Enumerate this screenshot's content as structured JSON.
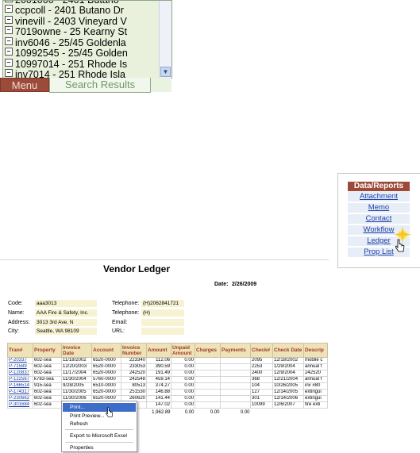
{
  "search_results": {
    "items": [
      "ccpcoll - 2401 Butano Dr",
      "vinevill - 2403 Vineyard V",
      "7019owne - 25 Kearny St",
      "inv6046 - 25/45 Goldenla",
      "10992545 - 25/45 Golden",
      "10997014 - 251 Rhode Is",
      "inv7014 - 251 Rhode Isla"
    ],
    "tabs": {
      "menu": "Menu",
      "search": "Search Results"
    }
  },
  "reports": {
    "header": "Data/Reports",
    "links": [
      "Attachment",
      "Memo",
      "Contact",
      "Workflow",
      "Ledger",
      "Prop List"
    ]
  },
  "ledger": {
    "title": "Vendor Ledger",
    "date_label": "Date:",
    "date": "2/26/2009",
    "fields": {
      "code_label": "Code:",
      "code": "aaa3013",
      "name_label": "Name:",
      "name": "AAA Fire & Safety, Inc.",
      "address_label": "Address:",
      "address": "3013 3rd Ave. N",
      "city_label": "City:",
      "city": "Seattle, WA 98109",
      "tel_label": "Telephone:",
      "tel": "(H)2062841721",
      "tel2_label": "Telephone:",
      "tel2": "(H)",
      "email_label": "Email:",
      "email": "",
      "url_label": "URL:",
      "url": ""
    },
    "columns": [
      "Tran#",
      "Property",
      "Invoice Date",
      "Account",
      "Invoice Number",
      "Amount",
      "Unpaid Amount",
      "Charges",
      "Payments",
      "Check#",
      "Check Date",
      "Descrip"
    ],
    "rows": [
      [
        "P-20337",
        "602-sea",
        "11/18/2002",
        "6520-0000",
        "223340",
        "112.06",
        "0.00",
        "",
        "",
        "2095",
        "12/18/2002",
        "mobile c"
      ],
      [
        "P-71589",
        "602-sea",
        "12/20/2003",
        "6520-0000",
        "233053",
        "390.59",
        "0.00",
        "",
        "",
        "2253",
        "1/29/2004",
        "annual f"
      ],
      [
        "P-120837",
        "602-sea",
        "11/17/2004",
        "6520-0000",
        "242520",
        "191.49",
        "0.00",
        "",
        "",
        "2400",
        "12/9/2004",
        "242520"
      ],
      [
        "P-122567",
        "k783-sea",
        "11/30/2004",
        "5760-0000",
        "242548",
        "459.14",
        "0.00",
        "",
        "",
        "368",
        "12/21/2004",
        "annual f"
      ],
      [
        "P-166514",
        "915-sea",
        "9/28/2005",
        "6510-0000",
        "80513",
        "374.27",
        "0.00",
        "",
        "",
        "104",
        "10/26/2005",
        "inv #80"
      ],
      [
        "P-174317",
        "602-sea",
        "11/30/2005",
        "6520-0000",
        "251530",
        "146.88",
        "0.00",
        "",
        "",
        "127",
        "12/14/2005",
        "extingui"
      ],
      [
        "P-230662",
        "602-sea",
        "11/30/2006",
        "6520-0000",
        "260620",
        "141.44",
        "0.00",
        "",
        "",
        "301",
        "12/14/2006",
        "extingui"
      ],
      [
        "P-301684",
        "602-sea",
        "",
        "",
        "",
        "147.02",
        "0.00",
        "",
        "",
        "10099",
        "12/6/2007",
        "fire exti"
      ]
    ],
    "totals": {
      "amount": "1,962.89",
      "unpaid": "0.00",
      "charges": "0.00",
      "payments": "0.00"
    }
  },
  "context_menu": {
    "items": [
      "Print...",
      "Print Preview...",
      "Refresh",
      "Export to Microsoft Excel",
      "Properties"
    ],
    "highlighted": "Print..."
  },
  "colors": {
    "accent_red": "#9c4a3a",
    "link_blue": "#1a3fa8",
    "list_bg": "#e9f1dd",
    "header_tan": "#efe2b6"
  }
}
